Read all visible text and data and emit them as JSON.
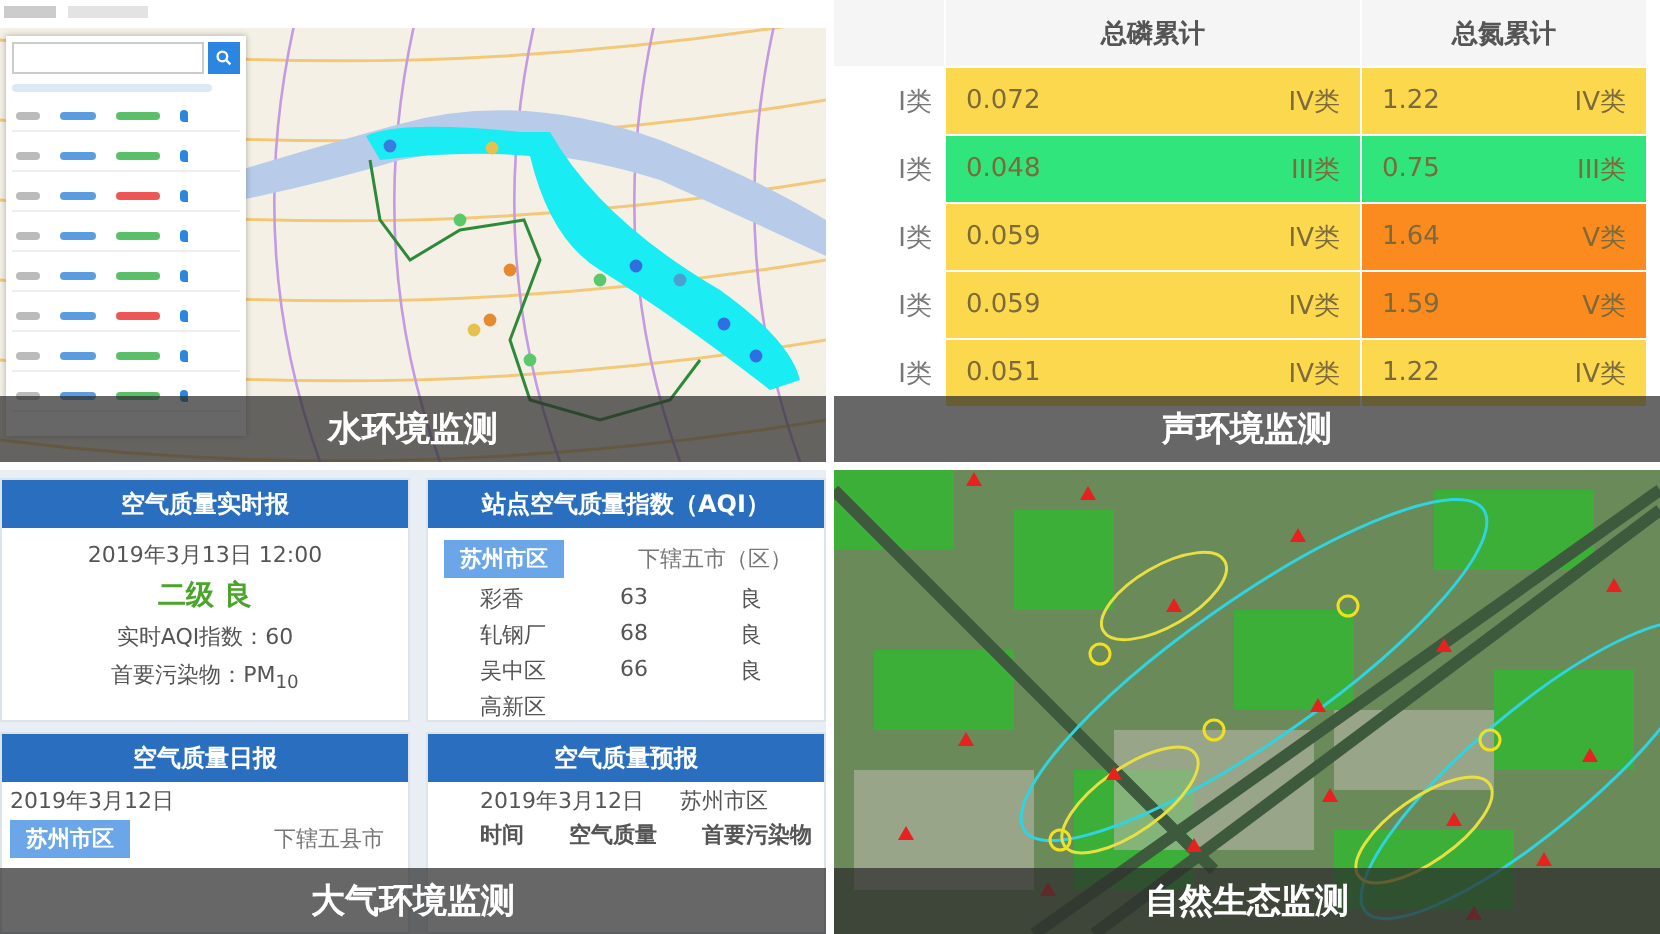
{
  "panels": [
    {
      "kind": "water_map",
      "caption": "水环境监测"
    },
    {
      "kind": "quality_table",
      "caption": "声环境监测",
      "table": {
        "columns": [
          "总磷累计",
          "总氮累计"
        ],
        "rows": [
          {
            "label": "I类",
            "cells": [
              {
                "value": "0.072",
                "class": "IV类",
                "color": "#fcd84e"
              },
              {
                "value": "1.22",
                "class": "IV类",
                "color": "#fcd84e"
              }
            ]
          },
          {
            "label": "I类",
            "cells": [
              {
                "value": "0.048",
                "class": "III类",
                "color": "#2fe57c"
              },
              {
                "value": "0.75",
                "class": "III类",
                "color": "#2fe57c"
              }
            ]
          },
          {
            "label": "I类",
            "cells": [
              {
                "value": "0.059",
                "class": "IV类",
                "color": "#fcd84e"
              },
              {
                "value": "1.64",
                "class": "V类",
                "color": "#fb8b1e"
              }
            ]
          },
          {
            "label": "I类",
            "cells": [
              {
                "value": "0.059",
                "class": "IV类",
                "color": "#fcd84e"
              },
              {
                "value": "1.59",
                "class": "V类",
                "color": "#fb8b1e"
              }
            ]
          },
          {
            "label": "I类",
            "cells": [
              {
                "value": "0.051",
                "class": "IV类",
                "color": "#fcd84e"
              },
              {
                "value": "1.22",
                "class": "IV类",
                "color": "#fcd84e"
              }
            ]
          }
        ]
      }
    },
    {
      "kind": "air_cards",
      "caption": "大气环境监测",
      "cards": [
        {
          "kind": "realtime",
          "title": "空气质量实时报",
          "datetime": "2019年3月13日 12:00",
          "grade": "二级 良",
          "aqi": "实时AQI指数：60",
          "pollutant": "首要污染物：PM$_{10}$"
        },
        {
          "kind": "stations",
          "title": "站点空气质量指数（AQI）",
          "tabs": [
            {
              "label": "苏州市区",
              "selected": true
            },
            {
              "label": "下辖五市（区）",
              "selected": false
            }
          ],
          "rows": [
            {
              "name": "彩香",
              "aqi": "63",
              "grade": "良"
            },
            {
              "name": "轧钢厂",
              "aqi": "68",
              "grade": "良"
            },
            {
              "name": "吴中区",
              "aqi": "66",
              "grade": "良"
            },
            {
              "name": "高新区"
            }
          ]
        },
        {
          "kind": "daily",
          "title": "空气质量日报",
          "date": "2019年3月12日",
          "tabs": [
            {
              "label": "苏州市区",
              "selected": true
            },
            {
              "label": "下辖五县市",
              "selected": false
            }
          ]
        },
        {
          "kind": "forecast",
          "title": "空气质量预报",
          "date": "2019年3月12日",
          "area": "苏州市区",
          "columns": [
            "时间",
            "空气质量",
            "首要污染物"
          ]
        }
      ]
    },
    {
      "kind": "satellite",
      "caption": "自然生态监测"
    }
  ]
}
